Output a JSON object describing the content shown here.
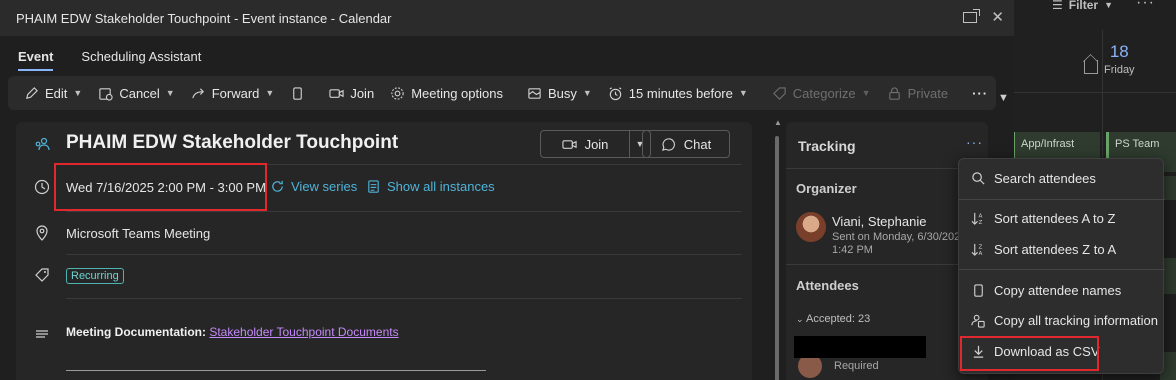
{
  "window": {
    "title": "PHAIM EDW Stakeholder Touchpoint - Event instance - Calendar"
  },
  "tabs": [
    {
      "label": "Event",
      "active": true
    },
    {
      "label": "Scheduling Assistant",
      "active": false
    }
  ],
  "toolbar": {
    "edit": "Edit",
    "cancel": "Cancel",
    "forward": "Forward",
    "join": "Join",
    "meeting_options": "Meeting options",
    "busy": "Busy",
    "reminder": "15 minutes before",
    "categorize": "Categorize",
    "private": "Private",
    "more": "···"
  },
  "event": {
    "subject": "PHAIM EDW Stakeholder Touchpoint",
    "join_button": "Join",
    "chat_button": "Chat",
    "datetime": "Wed 7/16/2025 2:00 PM - 3:00 PM",
    "view_series": "View series",
    "show_all_instances": "Show all instances",
    "location": "Microsoft Teams Meeting",
    "badge": "Recurring",
    "doc_label": "Meeting Documentation:",
    "doc_link": "Stakeholder Touchpoint Documents"
  },
  "tracking": {
    "title": "Tracking",
    "more": "···",
    "organizer_label": "Organizer",
    "organizer_name": "Viani, Stephanie",
    "organizer_sent": "Sent on Monday, 6/30/202",
    "organizer_time": "1:42 PM",
    "attendees_label": "Attendees",
    "accepted": "Accepted: 23",
    "required": "Required"
  },
  "menu": {
    "items": [
      {
        "label": "Search attendees",
        "icon": "search-icon"
      },
      {
        "label": "Sort attendees A to Z",
        "icon": "sort-az-icon"
      },
      {
        "label": "Sort attendees Z to A",
        "icon": "sort-za-icon"
      },
      {
        "label": "Copy attendee names",
        "icon": "copy-icon"
      },
      {
        "label": "Copy all tracking information",
        "icon": "people-copy-icon"
      },
      {
        "label": "Download as CSV",
        "icon": "download-icon"
      }
    ]
  },
  "background": {
    "filter": "Filter",
    "day_number": "18",
    "day_label": "Friday",
    "event1": "App/Infrast",
    "event2": "PS Team",
    "more": "···"
  },
  "colors": {
    "accent": "#8ab4f8",
    "highlight_box": "#e0282e",
    "link": "#4fb3d9",
    "doc_link": "#c58af9"
  }
}
